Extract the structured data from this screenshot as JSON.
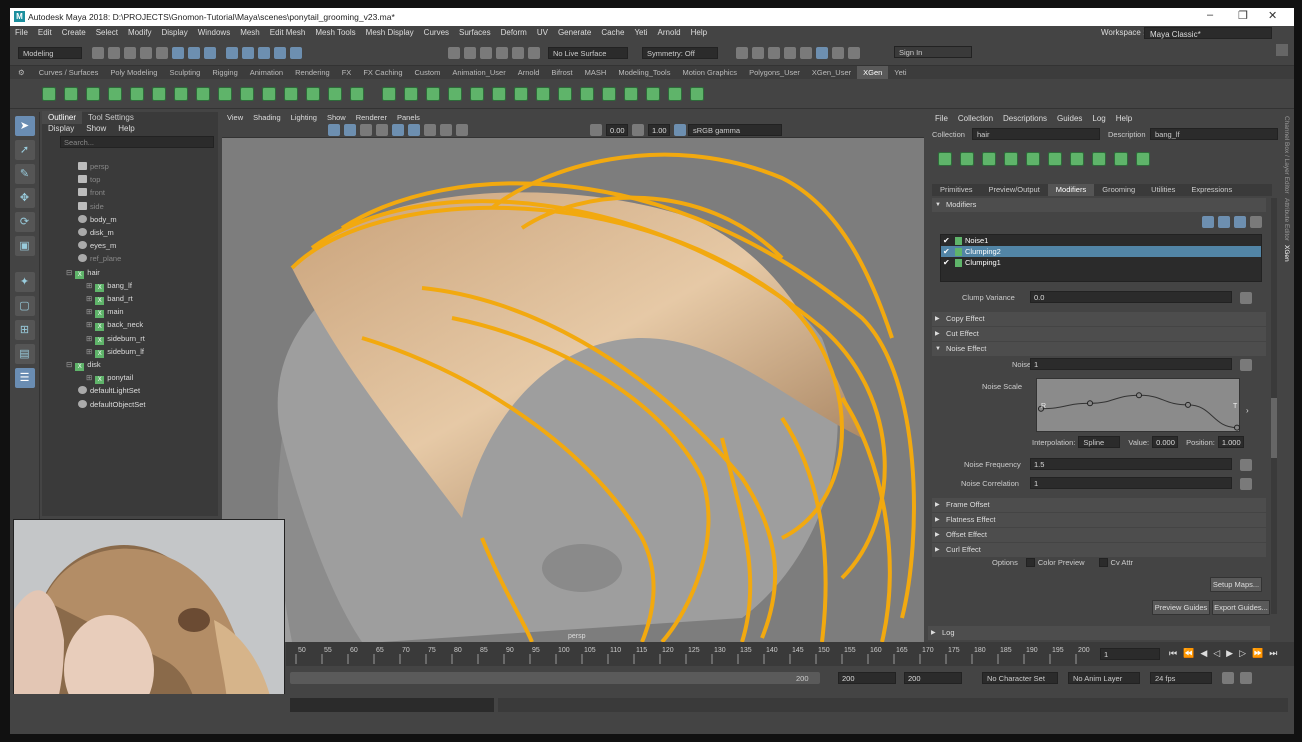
{
  "title": "Autodesk Maya 2018: D:\\PROJECTS\\Gnomon-Tutorial\\Maya\\scenes\\ponytail_grooming_v23.ma*",
  "menu": [
    "File",
    "Edit",
    "Create",
    "Select",
    "Modify",
    "Display",
    "Windows",
    "Mesh",
    "Edit Mesh",
    "Mesh Tools",
    "Mesh Display",
    "Curves",
    "Surfaces",
    "Deform",
    "UV",
    "Generate",
    "Cache",
    "Yeti",
    "Arnold",
    "Help"
  ],
  "workspace_label": "Workspace :",
  "workspace_value": "Maya Classic*",
  "mode_select": "Modeling",
  "live_surface": "No Live Surface",
  "symmetry": "Symmetry: Off",
  "sign_in": "Sign In",
  "shelf_tabs": [
    "Curves / Surfaces",
    "Poly Modeling",
    "Sculpting",
    "Rigging",
    "Animation",
    "Rendering",
    "FX",
    "FX Caching",
    "Custom",
    "Animation_User",
    "Arnold",
    "Bifrost",
    "MASH",
    "Modeling_Tools",
    "Motion Graphics",
    "Polygons_User",
    "XGen_User",
    "XGen",
    "Yeti"
  ],
  "shelf_active": "XGen",
  "outliner": {
    "tabs": [
      "Outliner",
      "Tool Settings"
    ],
    "menu": [
      "Display",
      "Show",
      "Help"
    ],
    "search": "Search...",
    "items": [
      {
        "label": "persp",
        "icon": "camera-icon",
        "dim": true,
        "indent": 0
      },
      {
        "label": "top",
        "icon": "camera-icon",
        "dim": true,
        "indent": 0
      },
      {
        "label": "front",
        "icon": "camera-icon",
        "dim": true,
        "indent": 0
      },
      {
        "label": "side",
        "icon": "camera-icon",
        "dim": true,
        "indent": 0
      },
      {
        "label": "body_m",
        "icon": "mesh-icon",
        "dim": false,
        "indent": 0
      },
      {
        "label": "disk_m",
        "icon": "mesh-icon",
        "dim": false,
        "indent": 0
      },
      {
        "label": "eyes_m",
        "icon": "mesh-icon",
        "dim": false,
        "indent": 0
      },
      {
        "label": "ref_plane",
        "icon": "mesh-icon",
        "dim": true,
        "indent": 0
      },
      {
        "label": "hair",
        "icon": "xgen-icon",
        "dim": false,
        "indent": -1
      },
      {
        "label": "bang_lf",
        "icon": "xgen-icon",
        "dim": false,
        "indent": 1
      },
      {
        "label": "band_rt",
        "icon": "xgen-icon",
        "dim": false,
        "indent": 1
      },
      {
        "label": "main",
        "icon": "xgen-icon",
        "dim": false,
        "indent": 1
      },
      {
        "label": "back_neck",
        "icon": "xgen-icon",
        "dim": false,
        "indent": 1
      },
      {
        "label": "sideburn_rt",
        "icon": "xgen-icon",
        "dim": false,
        "indent": 1
      },
      {
        "label": "sideburn_lf",
        "icon": "xgen-icon",
        "dim": false,
        "indent": 1
      },
      {
        "label": "disk",
        "icon": "xgen-icon",
        "dim": false,
        "indent": -1
      },
      {
        "label": "ponytail",
        "icon": "xgen-icon",
        "dim": false,
        "indent": 1
      },
      {
        "label": "defaultLightSet",
        "icon": "set-icon",
        "dim": false,
        "indent": 0
      },
      {
        "label": "defaultObjectSet",
        "icon": "set-icon",
        "dim": false,
        "indent": 0
      }
    ]
  },
  "viewport": {
    "menu": [
      "View",
      "Shading",
      "Lighting",
      "Show",
      "Renderer",
      "Panels"
    ],
    "exposure": "0.00",
    "gamma": "1.00",
    "color_space": "sRGB gamma",
    "camera_label": "persp"
  },
  "xgen": {
    "menu": [
      "File",
      "Collection",
      "Descriptions",
      "Guides",
      "Log",
      "Help"
    ],
    "collection_label": "Collection",
    "collection_value": "hair",
    "description_label": "Description",
    "description_value": "bang_lf",
    "tabs": [
      "Primitives",
      "Preview/Output",
      "Modifiers",
      "Grooming",
      "Utilities",
      "Expressions"
    ],
    "active_tab": "Modifiers",
    "modifiers_header": "Modifiers",
    "modifiers": [
      {
        "label": "Noise1",
        "selected": false
      },
      {
        "label": "Clumping2",
        "selected": true
      },
      {
        "label": "Clumping1",
        "selected": false
      }
    ],
    "clump_variance_label": "Clump Variance",
    "clump_variance": "0.0",
    "copy_effect": "Copy Effect",
    "cut_effect": "Cut Effect",
    "noise_effect": "Noise Effect",
    "noise_label": "Noise",
    "noise_value": "1",
    "noise_scale_label": "Noise Scale",
    "ramp_r": "R",
    "ramp_t": "T",
    "interp_label": "Interpolation:",
    "interp_value": "Spline",
    "value_label": "Value:",
    "value_value": "0.000",
    "position_label": "Position:",
    "position_value": "1.000",
    "noise_freq_label": "Noise Frequency",
    "noise_freq": "1.5",
    "noise_corr_label": "Noise Correlation",
    "noise_corr": "1",
    "frame_offset": "Frame Offset",
    "flatness_effect": "Flatness Effect",
    "offset_effect": "Offset Effect",
    "curl_effect": "Curl Effect",
    "options_label": "Options",
    "color_preview": "Color Preview",
    "cv_attr": "Cv Attr",
    "setup_maps": "Setup Maps...",
    "preview_guides": "Preview Guides",
    "export_guides": "Export Guides...",
    "log": "Log"
  },
  "side_tabs": [
    "Channel Box / Layer Editor",
    "Attribute Editor",
    "XGen"
  ],
  "timeline": {
    "ticks": [
      "50",
      "55",
      "60",
      "65",
      "70",
      "75",
      "80",
      "85",
      "90",
      "95",
      "100",
      "105",
      "110",
      "115",
      "120",
      "125",
      "130",
      "135",
      "140",
      "145",
      "150",
      "155",
      "160",
      "165",
      "170",
      "175",
      "180",
      "185",
      "190",
      "195",
      "200"
    ],
    "current": "1"
  },
  "range": {
    "end_a": "200",
    "end_b": "200",
    "end_c": "200"
  },
  "char_set": "No Character Set",
  "anim_layer": "No Anim Layer",
  "fps": "24 fps",
  "ramp_points": [
    [
      0,
      0.55
    ],
    [
      0.25,
      0.45
    ],
    [
      0.5,
      0.3
    ],
    [
      0.75,
      0.48
    ],
    [
      1.0,
      0.9
    ]
  ]
}
